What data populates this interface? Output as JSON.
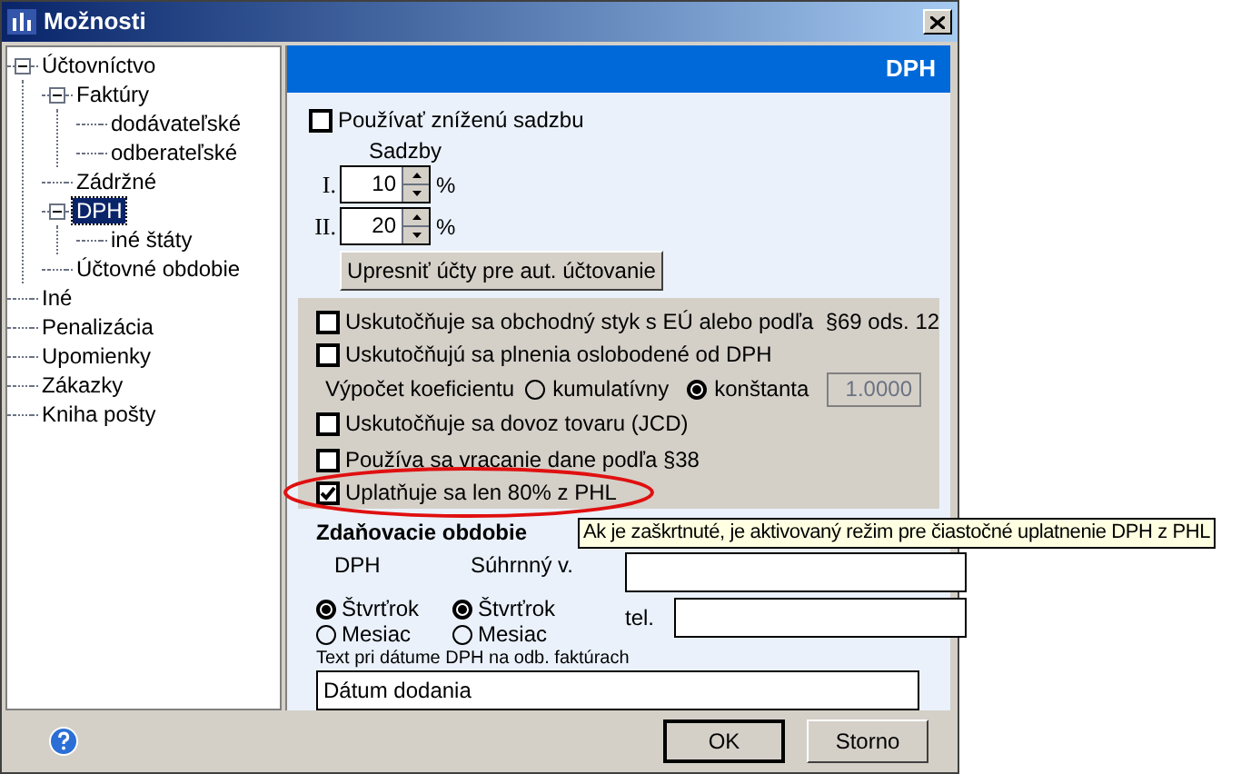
{
  "window": {
    "title": "Možnosti"
  },
  "tree": [
    {
      "label": "Účtovníctvo",
      "expanded": true,
      "selected": false,
      "children": [
        {
          "label": "Faktúry",
          "expanded": true,
          "selected": false,
          "children": [
            {
              "label": "dodávateľské",
              "selected": false
            },
            {
              "label": "odberateľské",
              "selected": false
            }
          ]
        },
        {
          "label": "Zádržné",
          "selected": false
        },
        {
          "label": "DPH",
          "expanded": true,
          "selected": true,
          "children": [
            {
              "label": "iné štáty",
              "selected": false
            }
          ]
        },
        {
          "label": "Účtovné obdobie",
          "selected": false
        }
      ]
    },
    {
      "label": "Iné",
      "selected": false
    },
    {
      "label": "Penalizácia",
      "selected": false
    },
    {
      "label": "Upomienky",
      "selected": false
    },
    {
      "label": "Zákazky",
      "selected": false
    },
    {
      "label": "Kniha pošty",
      "selected": false
    }
  ],
  "header": "DPH",
  "reduced_rate": {
    "label": "Používať zníženú sadzbu",
    "checked": false
  },
  "rates": {
    "label": "Sadzby",
    "items": [
      {
        "prefix": "I.",
        "value": "10",
        "unit": "%"
      },
      {
        "prefix": "II.",
        "value": "20",
        "unit": "%"
      }
    ]
  },
  "accounts_button": "Upresniť účty pre aut. účtovanie",
  "options": [
    {
      "kind": "checkbox",
      "label": "Uskutočňuje sa obchodný styk s EÚ alebo podľa  §69 ods. 12",
      "checked": false,
      "highlighted": false
    },
    {
      "kind": "checkbox",
      "label": "Uskutočňujú sa plnenia oslobodené od DPH",
      "checked": false,
      "highlighted": false
    },
    {
      "kind": "radio-row",
      "label": "Výpočet koeficientu",
      "choices": [
        {
          "label": "kumulatívny",
          "selected": false
        },
        {
          "label": "konštanta",
          "selected": true
        }
      ],
      "value": "1.0000",
      "disabled": true
    },
    {
      "kind": "checkbox",
      "label": "Uskutočňuje sa dovoz tovaru (JCD)",
      "checked": false,
      "highlighted": false
    },
    {
      "kind": "checkbox",
      "label": "Používa sa vracanie dane podľa §38",
      "checked": false,
      "highlighted": false
    },
    {
      "kind": "checkbox",
      "label": "Uplatňuje sa len 80% z PHL",
      "checked": true,
      "highlighted": true
    }
  ],
  "period": {
    "title": "Zdaňovacie obdobie",
    "groups": [
      {
        "label": "DPH",
        "choices": [
          {
            "label": "Štvrťrok",
            "selected": true
          },
          {
            "label": "Mesiac",
            "selected": false
          }
        ]
      },
      {
        "label": "Súhrnný v.",
        "choices": [
          {
            "label": "Štvrťrok",
            "selected": true
          },
          {
            "label": "Mesiac",
            "selected": false
          }
        ]
      }
    ],
    "phone_label": "tel.",
    "date_text_label": "Text pri dátume DPH na odb. faktúrach",
    "date_text_value": "Dátum dodania"
  },
  "tooltip": "Ak je zaškrtnuté, je aktivovaný režim pre čiastočné uplatnenie DPH z PHL",
  "buttons": [
    {
      "label": "OK",
      "default": true
    },
    {
      "label": "Storno",
      "default": false
    }
  ]
}
